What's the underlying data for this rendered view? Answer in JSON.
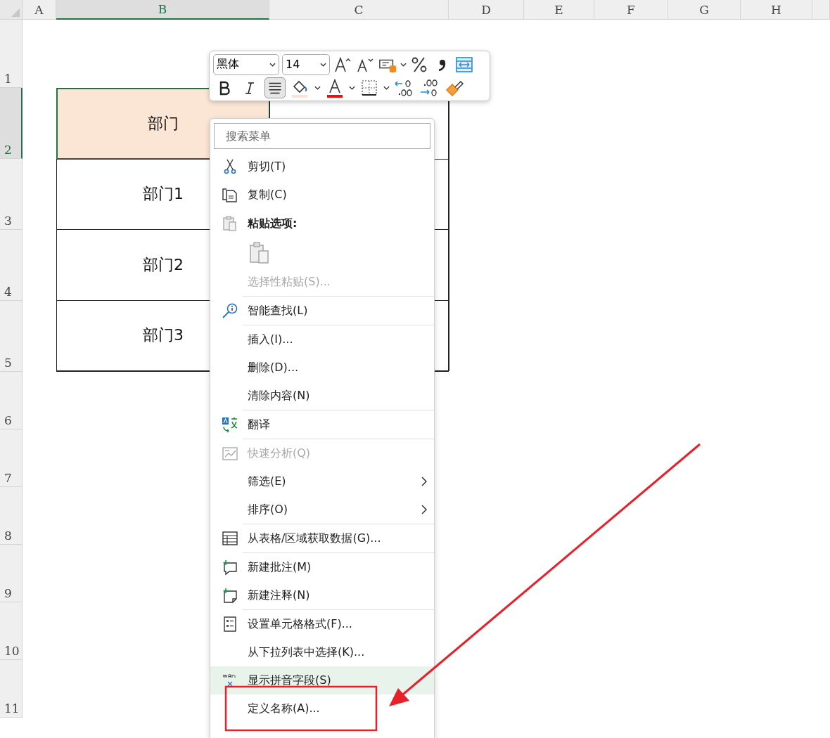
{
  "sheet": {
    "columns": [
      {
        "label": "A",
        "selected": false
      },
      {
        "label": "B",
        "selected": true
      },
      {
        "label": "C",
        "selected": false
      },
      {
        "label": "D",
        "selected": false
      },
      {
        "label": "E",
        "selected": false
      },
      {
        "label": "F",
        "selected": false
      },
      {
        "label": "G",
        "selected": false
      },
      {
        "label": "H",
        "selected": false
      }
    ],
    "rows": [
      {
        "label": "1",
        "selected": false
      },
      {
        "label": "2",
        "selected": true
      },
      {
        "label": "3",
        "selected": false
      },
      {
        "label": "4",
        "selected": false
      },
      {
        "label": "5",
        "selected": false
      },
      {
        "label": "6",
        "selected": false
      },
      {
        "label": "7",
        "selected": false
      },
      {
        "label": "8",
        "selected": false
      },
      {
        "label": "9",
        "selected": false
      },
      {
        "label": "10",
        "selected": false
      },
      {
        "label": "11",
        "selected": false
      }
    ],
    "table": [
      {
        "cells": [
          "部门",
          ""
        ],
        "header": true,
        "selected": true
      },
      {
        "cells": [
          "部门1",
          ""
        ],
        "header": false,
        "selected": false
      },
      {
        "cells": [
          "部门2",
          ""
        ],
        "header": false,
        "selected": false
      },
      {
        "cells": [
          "部门3",
          ""
        ],
        "header": false,
        "selected": false
      }
    ]
  },
  "toolbar": {
    "font": "黑体",
    "size": "14",
    "row1": [
      {
        "kind": "grow_font"
      },
      {
        "kind": "shrink_font"
      },
      {
        "kind": "number_format"
      },
      {
        "kind": "percent"
      },
      {
        "kind": "comma"
      },
      {
        "kind": "wrap"
      }
    ],
    "row2": [
      {
        "kind": "bold",
        "selected": false
      },
      {
        "kind": "italic",
        "selected": false
      },
      {
        "kind": "align_center",
        "selected": true
      },
      {
        "kind": "fill_color",
        "selected": false
      },
      {
        "kind": "font_color",
        "selected": false
      },
      {
        "kind": "borders",
        "selected": false
      },
      {
        "kind": "increase_decimal",
        "selected": false
      },
      {
        "kind": "decrease_decimal",
        "selected": false
      },
      {
        "kind": "format_painter",
        "selected": false
      }
    ]
  },
  "context_menu": {
    "search": {
      "placeholder": "搜索菜单"
    },
    "items": [
      {
        "kind": "item",
        "label": "剪切(T)",
        "disabled": false,
        "submenu": false,
        "highlighted": false
      },
      {
        "kind": "item",
        "label": "复制(C)",
        "disabled": false,
        "submenu": false,
        "highlighted": false
      },
      {
        "kind": "header",
        "label": "粘贴选项:"
      },
      {
        "kind": "paste_icon"
      },
      {
        "kind": "item",
        "label": "选择性粘贴(S)...",
        "disabled": true,
        "submenu": false,
        "highlighted": false
      },
      {
        "kind": "separator"
      },
      {
        "kind": "item",
        "label": "智能查找(L)",
        "disabled": false,
        "submenu": false,
        "highlighted": false
      },
      {
        "kind": "separator"
      },
      {
        "kind": "item",
        "label": "插入(I)...",
        "disabled": false,
        "submenu": false,
        "highlighted": false
      },
      {
        "kind": "item",
        "label": "删除(D)...",
        "disabled": false,
        "submenu": false,
        "highlighted": false
      },
      {
        "kind": "item",
        "label": "清除内容(N)",
        "disabled": false,
        "submenu": false,
        "highlighted": false
      },
      {
        "kind": "separator"
      },
      {
        "kind": "item",
        "label": "翻译",
        "disabled": false,
        "submenu": false,
        "highlighted": false
      },
      {
        "kind": "separator"
      },
      {
        "kind": "item",
        "label": "快速分析(Q)",
        "disabled": true,
        "submenu": false,
        "highlighted": false
      },
      {
        "kind": "item",
        "label": "筛选(E)",
        "disabled": false,
        "submenu": true,
        "highlighted": false
      },
      {
        "kind": "item",
        "label": "排序(O)",
        "disabled": false,
        "submenu": true,
        "highlighted": false
      },
      {
        "kind": "separator"
      },
      {
        "kind": "item",
        "label": "从表格/区域获取数据(G)...",
        "disabled": false,
        "submenu": false,
        "highlighted": false
      },
      {
        "kind": "separator"
      },
      {
        "kind": "item",
        "label": "新建批注(M)",
        "disabled": false,
        "submenu": false,
        "highlighted": false
      },
      {
        "kind": "item",
        "label": "新建注释(N)",
        "disabled": false,
        "submenu": false,
        "highlighted": false
      },
      {
        "kind": "separator"
      },
      {
        "kind": "item",
        "label": "设置单元格格式(F)...",
        "disabled": false,
        "submenu": false,
        "highlighted": false
      },
      {
        "kind": "item",
        "label": "从下拉列表中选择(K)...",
        "disabled": false,
        "submenu": false,
        "highlighted": false
      },
      {
        "kind": "item",
        "label": "显示拼音字段(S)",
        "disabled": false,
        "submenu": false,
        "highlighted": true
      },
      {
        "kind": "item",
        "label": "定义名称(A)...",
        "disabled": false,
        "submenu": false,
        "highlighted": false
      }
    ]
  },
  "annotations": {
    "highlight_box": true,
    "arrow": true
  }
}
